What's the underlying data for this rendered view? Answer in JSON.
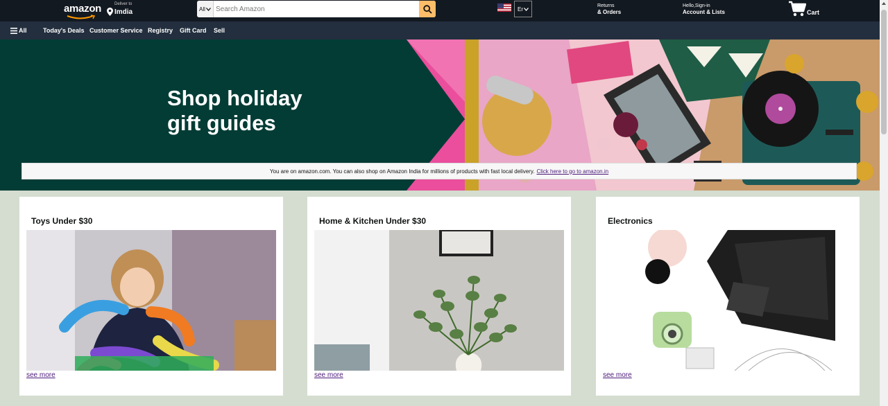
{
  "header": {
    "logo_text": "amazon",
    "deliver_label": "Deliver to",
    "deliver_location": "Imdia",
    "search": {
      "category": "All",
      "placeholder": "Search Amazon"
    },
    "language": "Er",
    "returns": {
      "line1": "Returns",
      "line2": "& Orders"
    },
    "account": {
      "line1": "Hello,Sign-in",
      "line2": "Account & Lists"
    },
    "cart_label": "Cart"
  },
  "subnav": {
    "all_label": "All",
    "items": [
      "Today's Deals",
      "Customer Service",
      "Registry",
      "Gift Card",
      "Sell"
    ]
  },
  "hero": {
    "title_line1": "Shop holiday",
    "title_line2": "gift guides",
    "notice_text": "You are on amazon.com. You can also shop on Amazon India for millions of products with fast local delivery.",
    "notice_link": "Click here to go to amazon.in"
  },
  "cards": [
    {
      "title": "Toys Under $30",
      "link": "see more"
    },
    {
      "title": "Home & Kitchen Under $30",
      "link": "see more"
    },
    {
      "title": "Electronics",
      "link": "see more"
    }
  ],
  "colors": {
    "nav_bg": "#131921",
    "subnav_bg": "#232f3e",
    "search_button": "#febd69",
    "hero_green": "#033c35",
    "hero_pink": "#ea4e9c",
    "link_purple": "#4c1a7a",
    "cards_bg": "#d4ddd0"
  },
  "icons": [
    "search-icon",
    "location-pin-icon",
    "cart-icon",
    "menu-icon",
    "chevron-down-icon",
    "us-flag-icon"
  ]
}
